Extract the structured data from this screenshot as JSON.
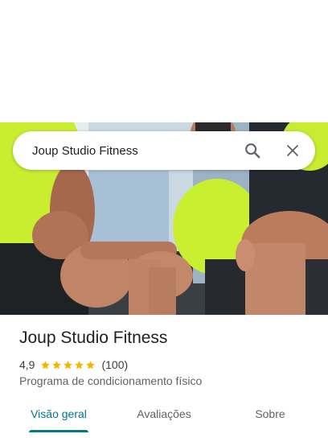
{
  "search": {
    "query": "Joup Studio Fitness",
    "search_icon": "search-icon",
    "close_icon": "close-icon"
  },
  "place": {
    "name": "Joup Studio Fitness",
    "rating": "4,9",
    "stars": 5,
    "review_count": "(100)",
    "category": "Programa de condicionamento físico"
  },
  "tabs": [
    {
      "label": "Visão geral",
      "active": true
    },
    {
      "label": "Avaliações",
      "active": false
    },
    {
      "label": "Sobre",
      "active": false
    }
  ],
  "colors": {
    "accent": "#00798c",
    "star": "#f5b400",
    "shirt": "#c8f032"
  }
}
